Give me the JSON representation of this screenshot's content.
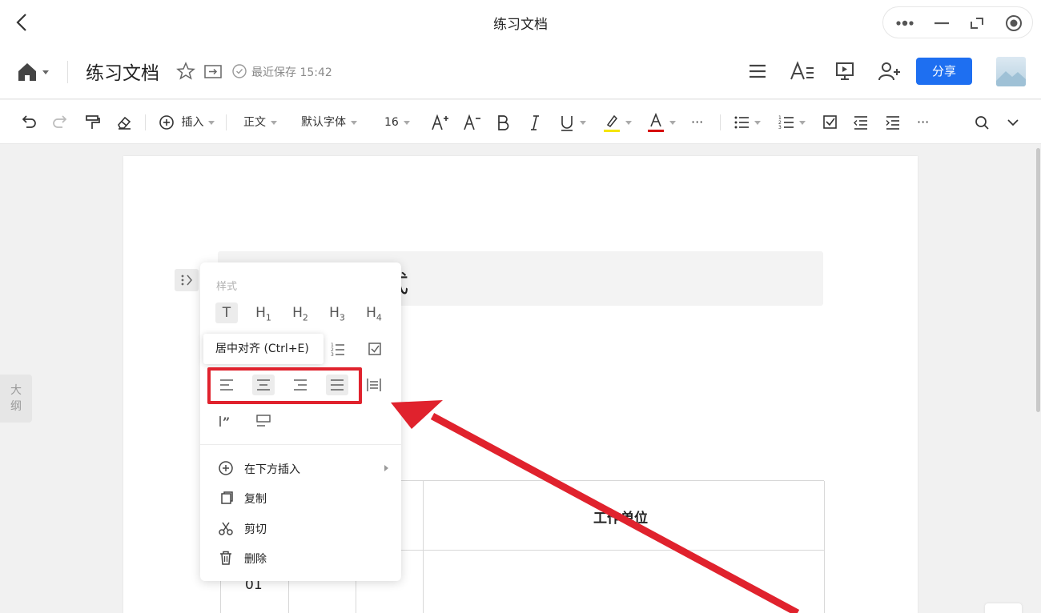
{
  "window": {
    "title": "练习文档"
  },
  "doc_header": {
    "doc_name": "练习文档",
    "save_status": "最近保存 15:42",
    "share_label": "分享"
  },
  "toolbar": {
    "insert_label": "插入",
    "style_label": "正文",
    "font_label": "默认字体",
    "size_label": "16",
    "more_label": "···",
    "more2_label": "···",
    "highlight_color": "#f5e500",
    "font_color": "#d60000"
  },
  "document": {
    "heading_visible_text": "式",
    "table_header": "工作单位",
    "table_row_id": "01"
  },
  "outline": {
    "label_line1": "大",
    "label_line2": "纲"
  },
  "menu": {
    "style_section_label": "样式",
    "headings": [
      "T",
      "H",
      "H",
      "H",
      "H"
    ],
    "heading_subs": [
      "",
      "1",
      "2",
      "3",
      "4"
    ],
    "items": [
      {
        "label": "在下方插入",
        "icon": "plus-circle-icon"
      },
      {
        "label": "复制",
        "icon": "copy-icon"
      },
      {
        "label": "剪切",
        "icon": "scissors-icon"
      },
      {
        "label": "删除",
        "icon": "trash-icon"
      }
    ]
  },
  "tooltip": {
    "text": "居中对齐 (Ctrl+E)"
  },
  "annotation": {
    "color": "#e0222d"
  }
}
